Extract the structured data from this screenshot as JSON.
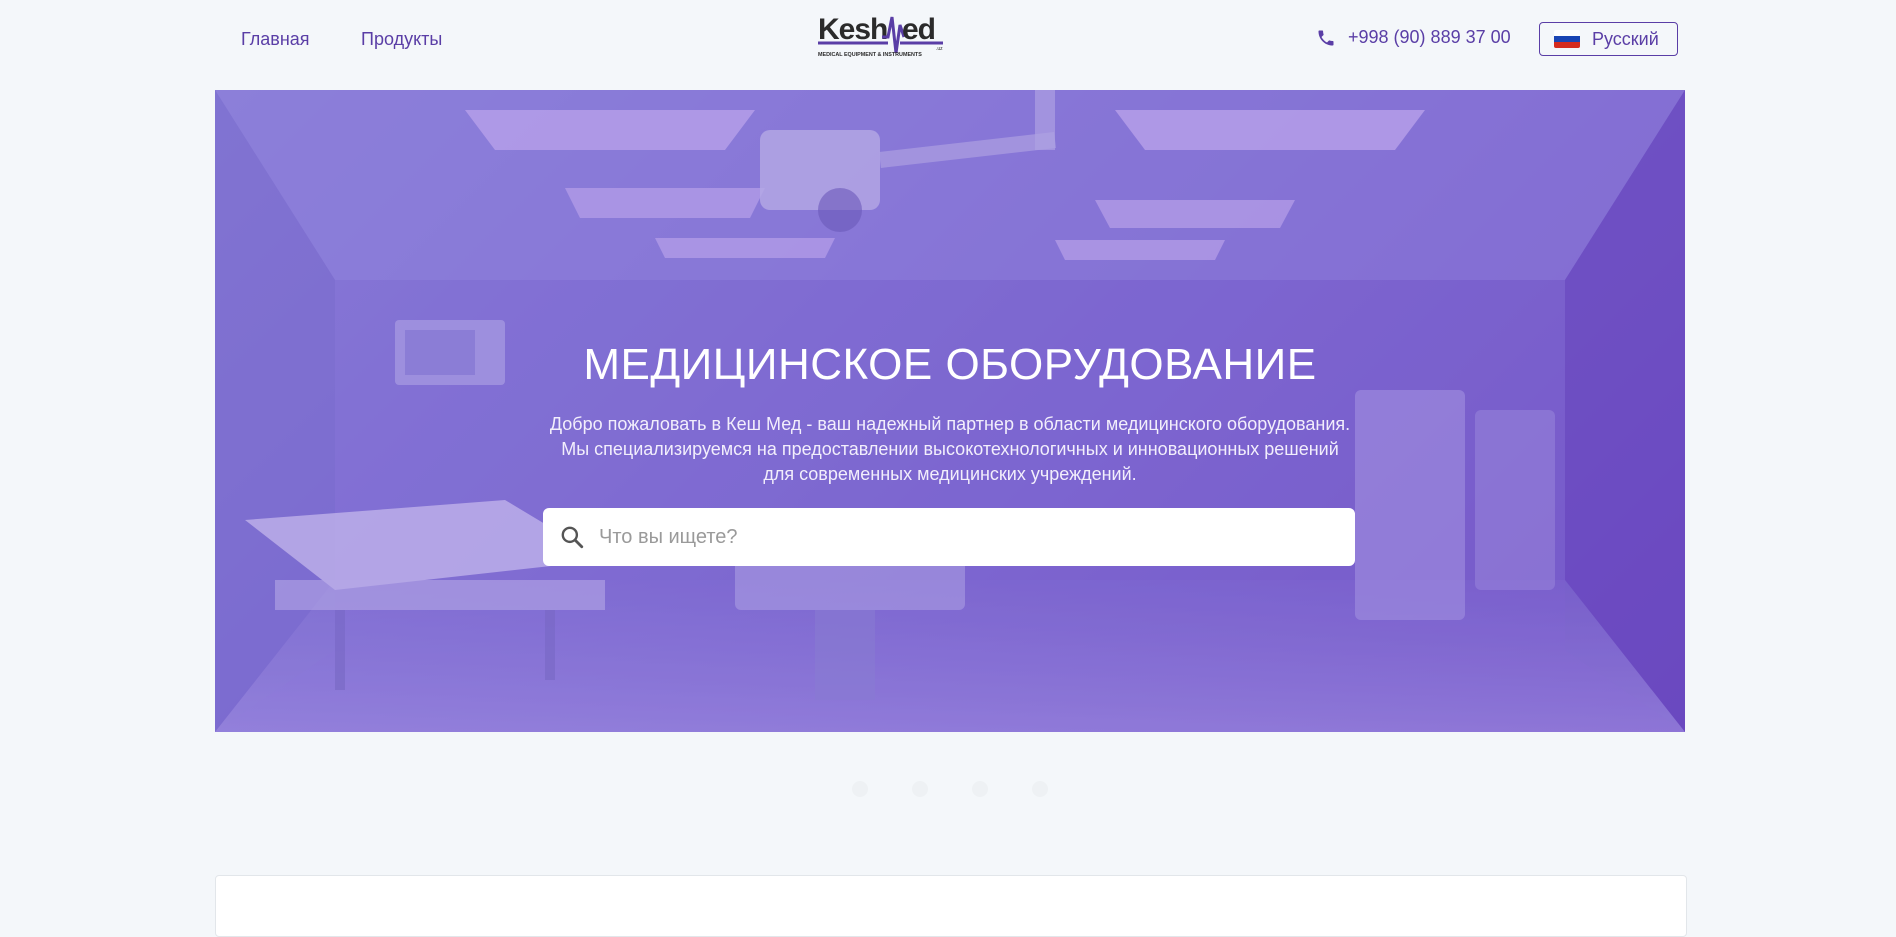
{
  "header": {
    "nav": [
      {
        "label": "Главная"
      },
      {
        "label": "Продукты"
      }
    ],
    "logo": {
      "text": "KeshMed",
      "tld": ".uz",
      "tagline": "MEDICAL EQUIPMENT & INSTRUMENTS"
    },
    "phone": {
      "icon": "phone-icon",
      "number": "+998 (90) 889 37 00"
    },
    "language": {
      "label": "Русский",
      "flag": "russia-flag-icon"
    }
  },
  "hero": {
    "title": "МЕДИЦИНСКОЕ ОБОРУДОВАНИЕ",
    "text_lines": [
      "Добро пожаловать в Кеш Мед - ваш надежный партнер в области медицинского оборудования.",
      "Мы специализируемся на предоставлении высокотехнологичных и инновационных решений",
      "для современных медицинских учреждений."
    ],
    "search": {
      "icon": "search-icon",
      "placeholder": "Что вы ищете?",
      "value": ""
    }
  },
  "carousel": {
    "count": 4,
    "active": 0
  },
  "colors": {
    "accent": "#5a3ea6",
    "hero_overlay": "#7d6ad3",
    "background": "#f4f7fa"
  }
}
